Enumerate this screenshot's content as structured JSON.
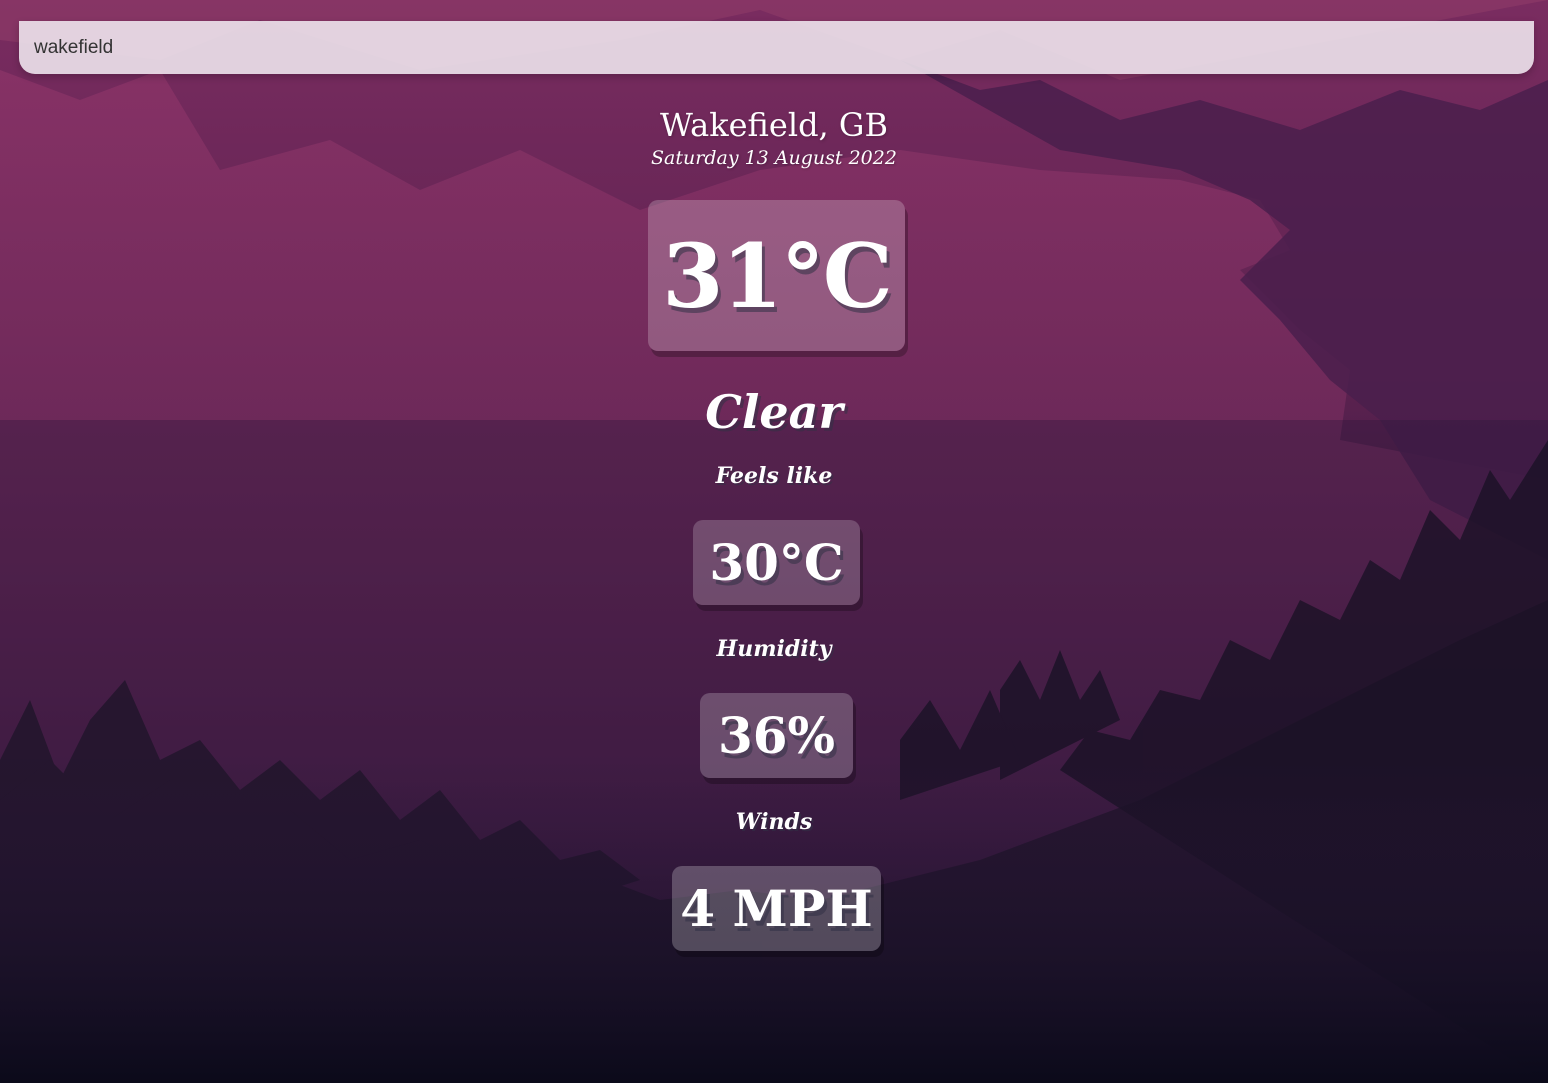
{
  "search": {
    "value": "wakefield",
    "placeholder": ""
  },
  "location": {
    "city_country": "Wakefield, GB",
    "date": "Saturday 13 August 2022"
  },
  "weather": {
    "temperature": "31°C",
    "condition": "Clear",
    "feels_like_label": "Feels like",
    "feels_like_value": "30°C",
    "humidity_label": "Humidity",
    "humidity_value": "36%",
    "winds_label": "Winds",
    "winds_value": "4 MPH"
  }
}
